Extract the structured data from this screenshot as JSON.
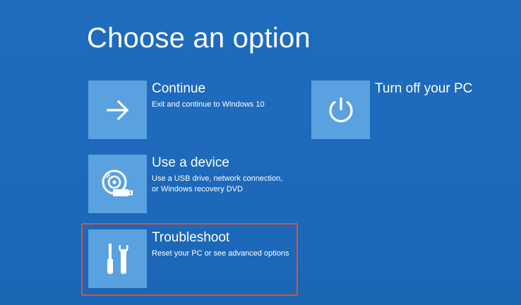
{
  "page": {
    "title": "Choose an option"
  },
  "options": {
    "continue": {
      "label": "Continue",
      "description_line1": "Exit and continue to Windows 10",
      "icon": "arrow-right-icon"
    },
    "use_device": {
      "label": "Use a device",
      "description_line1": "Use a USB drive, network connection,",
      "description_line2": "or Windows recovery DVD",
      "icon": "disc-drive-icon"
    },
    "troubleshoot": {
      "label": "Troubleshoot",
      "description_line1": "Reset your PC or see advanced options",
      "icon": "tools-icon",
      "highlighted": true
    },
    "turn_off": {
      "label": "Turn off your PC",
      "icon": "power-icon"
    }
  },
  "colors": {
    "background": "#1d68b9",
    "tile": "#5aa1e0",
    "text": "#ffffff",
    "highlight": "#d8533a"
  }
}
